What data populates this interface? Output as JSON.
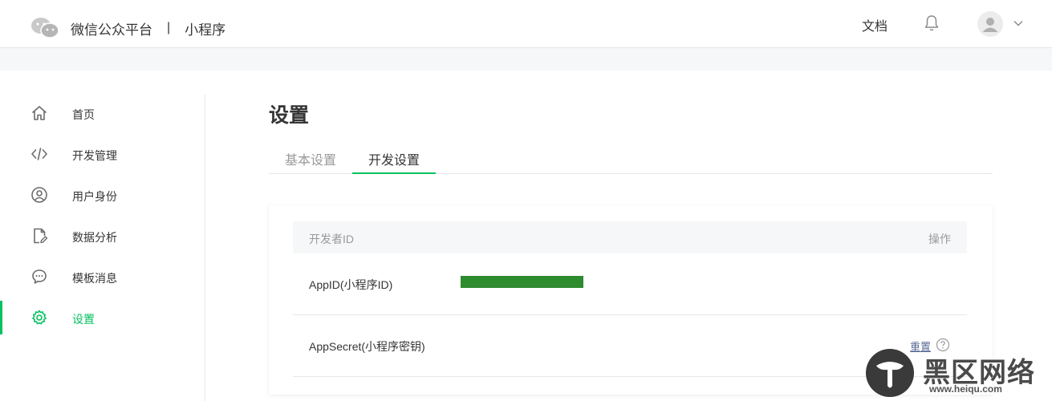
{
  "header": {
    "brand_name": "微信公众平台",
    "separator": "|",
    "product": "小程序",
    "docs_label": "文档",
    "icons": [
      "wechat-logo-icon",
      "bell-icon",
      "avatar-icon",
      "chevron-down-icon"
    ]
  },
  "sidebar": {
    "items": [
      {
        "label": "首页",
        "icon": "home-icon"
      },
      {
        "label": "开发管理",
        "icon": "code-icon"
      },
      {
        "label": "用户身份",
        "icon": "user-circle-icon"
      },
      {
        "label": "数据分析",
        "icon": "document-edit-icon"
      },
      {
        "label": "模板消息",
        "icon": "chat-bubble-icon"
      },
      {
        "label": "设置",
        "icon": "gear-icon",
        "active": true
      }
    ]
  },
  "main": {
    "title": "设置",
    "tabs": [
      {
        "label": "基本设置",
        "active": false
      },
      {
        "label": "开发设置",
        "active": true
      }
    ],
    "table": {
      "header_left": "开发者ID",
      "header_right": "操作",
      "rows": [
        {
          "label": "AppID(小程序ID)",
          "value_redacted": true
        },
        {
          "label": "AppSecret(小程序密钥)",
          "action": "重置"
        }
      ]
    }
  },
  "watermark": {
    "title": "黑区网络",
    "url": "www.heiqu.com"
  },
  "colors": {
    "accent": "#07c160",
    "link": "#576b95",
    "redaction": "#2e8b2e"
  }
}
